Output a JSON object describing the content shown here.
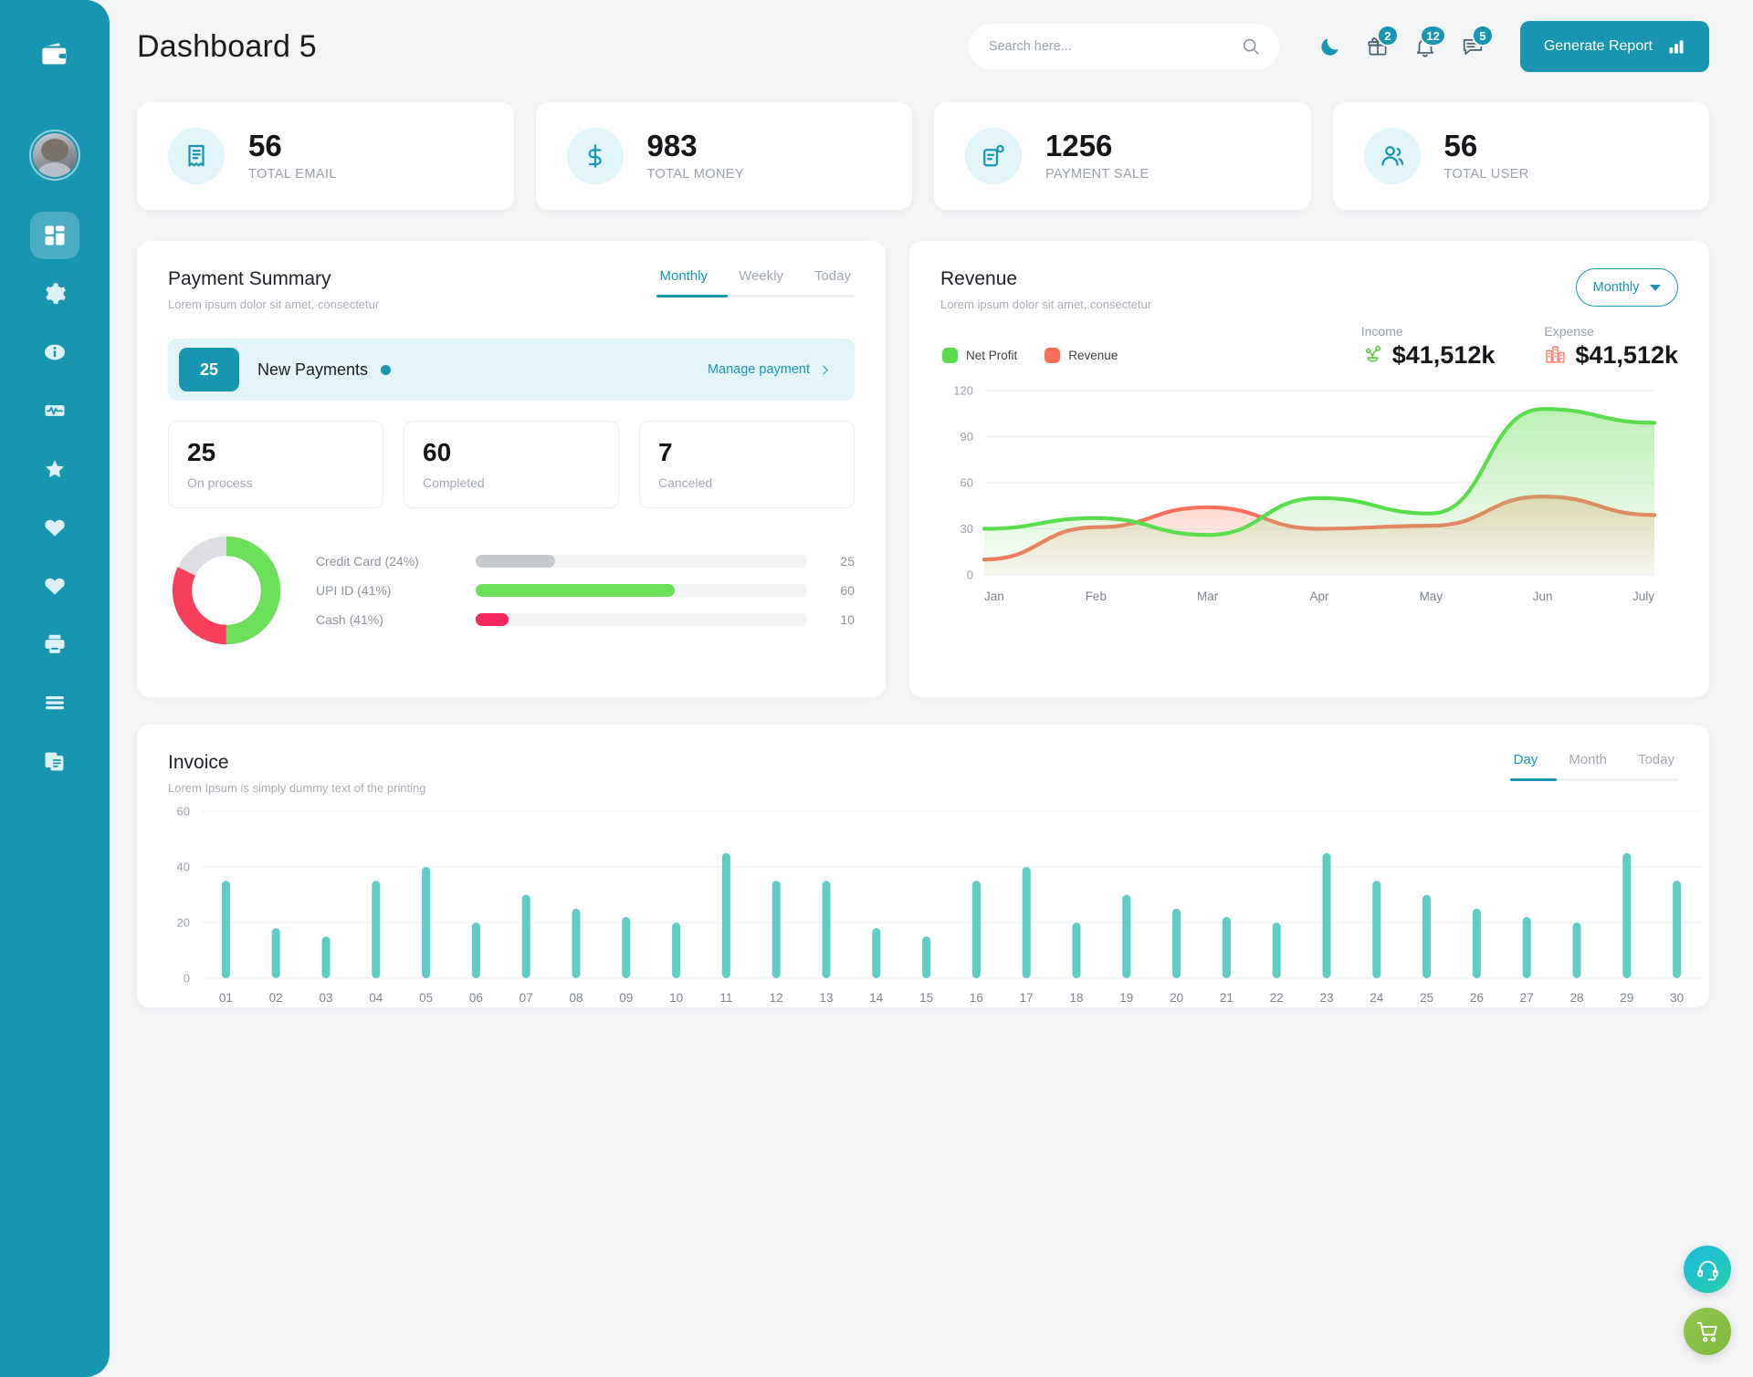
{
  "app": {
    "title": "Dashboard 5",
    "brand_icon": "wallet-icon",
    "accent": "#1896b0"
  },
  "sidebar": {
    "items": [
      {
        "name": "dashboard",
        "icon": "grid-icon",
        "active": true
      },
      {
        "name": "settings",
        "icon": "gear-icon",
        "active": false
      },
      {
        "name": "info",
        "icon": "info-icon",
        "active": false
      },
      {
        "name": "analytics",
        "icon": "pulse-icon",
        "active": false
      },
      {
        "name": "favorites",
        "icon": "star-icon",
        "active": false
      },
      {
        "name": "likes",
        "icon": "heart-icon",
        "active": false
      },
      {
        "name": "saved",
        "icon": "heart-icon",
        "active": false
      },
      {
        "name": "print",
        "icon": "printer-icon",
        "active": false
      },
      {
        "name": "menu",
        "icon": "menu-icon",
        "active": false
      },
      {
        "name": "documents",
        "icon": "documents-icon",
        "active": false
      }
    ]
  },
  "topbar": {
    "search_placeholder": "Search here...",
    "search_value": "",
    "search_icon": "search-icon",
    "dark_mode_icon": "moon-icon",
    "gift_icon": "gift-icon",
    "gift_badge": "2",
    "bell_icon": "bell-icon",
    "bell_badge": "12",
    "chat_icon": "chat-icon",
    "chat_badge": "5",
    "generate_report_label": "Generate Report",
    "generate_report_icon": "bar-chart-icon"
  },
  "stats": [
    {
      "value": "56",
      "label": "TOTAL EMAIL",
      "icon": "receipt-icon"
    },
    {
      "value": "983",
      "label": "TOTAL MONEY",
      "icon": "dollar-icon"
    },
    {
      "value": "1256",
      "label": "PAYMENT SALE",
      "icon": "invoice-icon"
    },
    {
      "value": "56",
      "label": "TOTAL USER",
      "icon": "users-icon"
    }
  ],
  "payment_summary": {
    "title": "Payment Summary",
    "subtitle": "Lorem ipsum dolor sit amet, consectetur",
    "tabs": [
      {
        "label": "Monthly",
        "active": true
      },
      {
        "label": "Weekly",
        "active": false
      },
      {
        "label": "Today",
        "active": false
      }
    ],
    "new_payments": {
      "count": "25",
      "label": "New Payments",
      "action_label": "Manage payment",
      "action_icon": "chevron-right-icon"
    },
    "mini_cards": [
      {
        "value": "25",
        "label": "On process"
      },
      {
        "value": "60",
        "label": "Completed"
      },
      {
        "value": "7",
        "label": "Canceled"
      }
    ],
    "chart_data": {
      "type": "pie",
      "title": "Payment Methods",
      "labels": [
        "Credit Card (24%)",
        "UPI ID (41%)",
        "Cash (41%)"
      ],
      "values": [
        25,
        60,
        10
      ],
      "percents": [
        24,
        41,
        41
      ],
      "colors": [
        "#c6c9cd",
        "#6ce05b",
        "#f73f5c"
      ],
      "donut_segments": [
        {
          "name": "UPI ID",
          "color": "#6ce05b",
          "percent": 50
        },
        {
          "name": "Cash",
          "color": "#f73f5c",
          "percent": 32
        },
        {
          "name": "Credit Card",
          "color": "#dcdee1",
          "percent": 18
        }
      ],
      "bars": [
        {
          "label": "Credit Card (24%)",
          "value": 25,
          "fill_pct": 24,
          "color": "#c6c9cd"
        },
        {
          "label": "UPI ID (41%)",
          "value": 60,
          "fill_pct": 60,
          "color": "#6ce05b"
        },
        {
          "label": "Cash (41%)",
          "value": 10,
          "fill_pct": 10,
          "color": "#f4285a"
        }
      ]
    }
  },
  "revenue": {
    "title": "Revenue",
    "subtitle": "Lorem ipsum dolor sit amet, consectetur",
    "select_value": "Monthly",
    "income": {
      "label": "Income",
      "value": "$41,512k",
      "icon": "money-plant-icon"
    },
    "expense": {
      "label": "Expense",
      "value": "$41,512k",
      "icon": "buildings-icon"
    },
    "chart_data": {
      "type": "area",
      "title": "Revenue",
      "x": [
        "Jan",
        "Feb",
        "Mar",
        "Apr",
        "May",
        "Jun",
        "July"
      ],
      "ylim": [
        0,
        120
      ],
      "yticks": [
        0,
        30,
        60,
        90,
        120
      ],
      "xlabel": "",
      "ylabel": "",
      "grid": true,
      "legend_position": "top-left",
      "series": [
        {
          "name": "Net Profit",
          "color": "#59dd4d",
          "values": [
            30,
            37,
            26,
            50,
            40,
            108,
            99
          ]
        },
        {
          "name": "Revenue",
          "color": "#f8705a",
          "values": [
            10,
            31,
            44,
            30,
            32,
            51,
            39
          ]
        }
      ]
    }
  },
  "invoice": {
    "title": "Invoice",
    "subtitle": "Lorem Ipsum is simply dummy text of the printing",
    "tabs": [
      {
        "label": "Day",
        "active": true
      },
      {
        "label": "Month",
        "active": false
      },
      {
        "label": "Today",
        "active": false
      }
    ],
    "chart_data": {
      "type": "bar",
      "title": "Invoice",
      "xlabel": "",
      "ylabel": "",
      "ylim": [
        0,
        60
      ],
      "yticks": [
        0,
        20,
        40,
        60
      ],
      "grid": true,
      "bar_color": "#5fcdc4",
      "categories": [
        "01",
        "02",
        "03",
        "04",
        "05",
        "06",
        "07",
        "08",
        "09",
        "10",
        "11",
        "12",
        "13",
        "14",
        "15",
        "16",
        "17",
        "18",
        "19",
        "20",
        "21",
        "22",
        "23",
        "24",
        "25",
        "26",
        "27",
        "28",
        "29",
        "30"
      ],
      "values": [
        35,
        18,
        15,
        35,
        40,
        20,
        30,
        25,
        22,
        20,
        45,
        35,
        35,
        18,
        15,
        35,
        40,
        20,
        30,
        25,
        22,
        20,
        45,
        35,
        30,
        25,
        22,
        20,
        45,
        35
      ]
    }
  },
  "floating": {
    "support_icon": "headset-icon",
    "cart_icon": "shopping-cart-icon"
  }
}
